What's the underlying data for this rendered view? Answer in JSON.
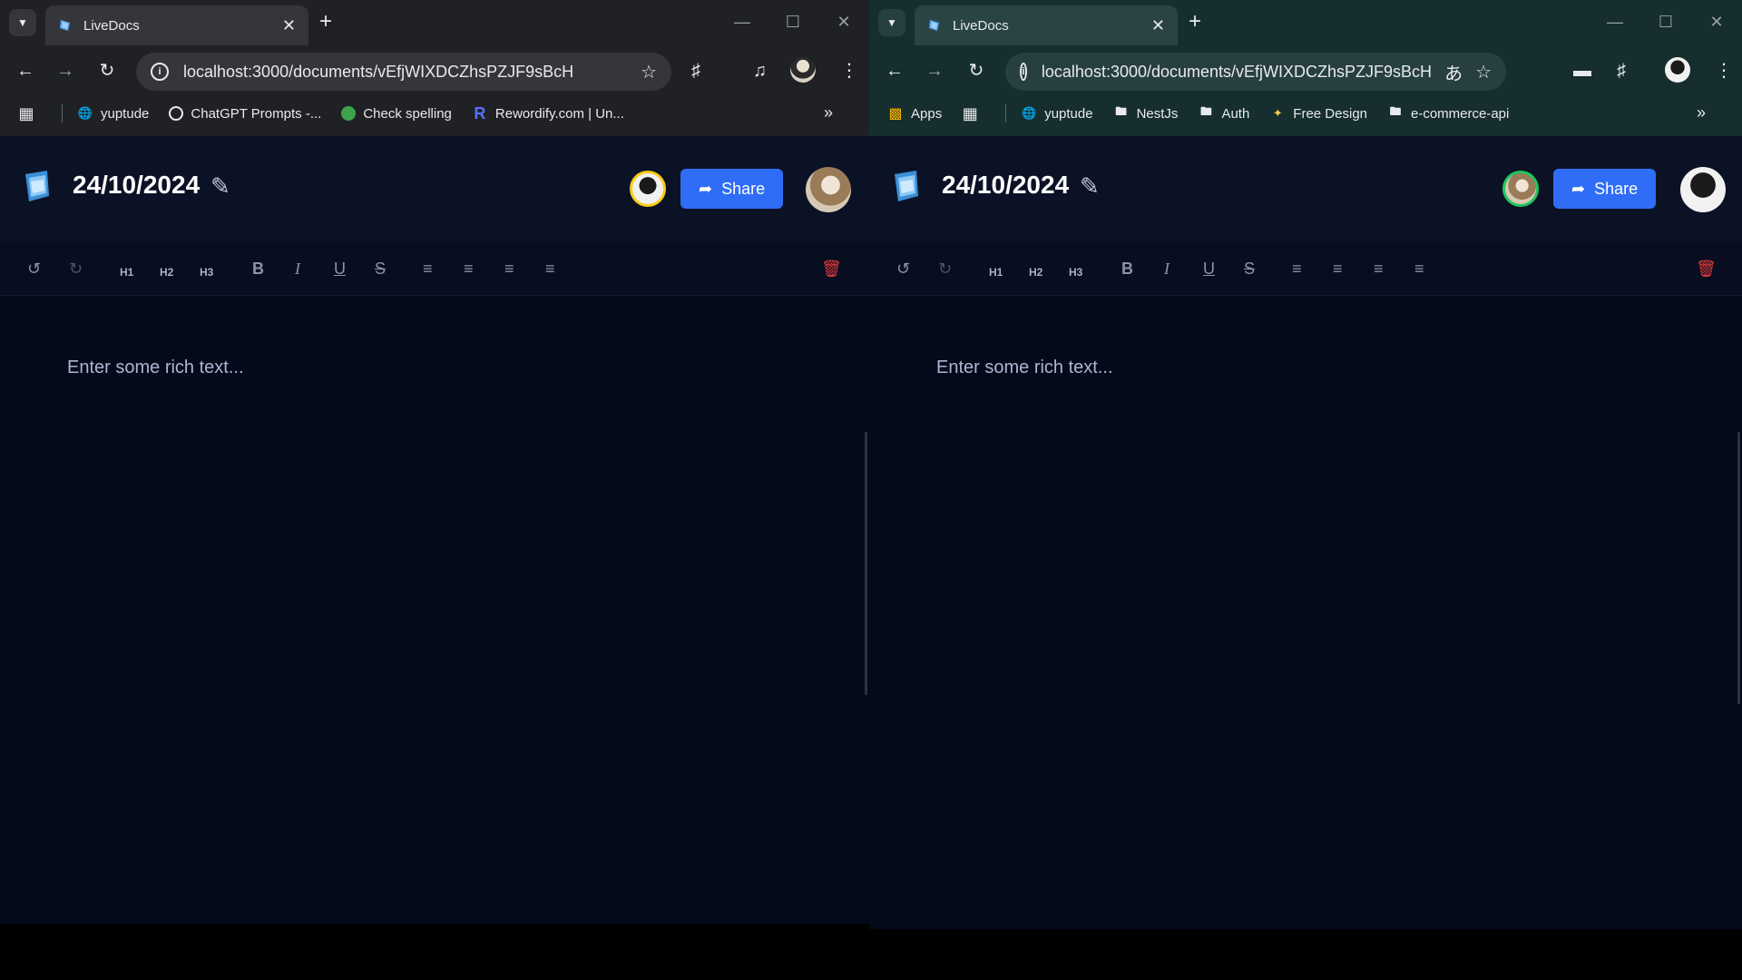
{
  "windows": [
    {
      "id": "left",
      "tab": {
        "title": "LiveDocs"
      },
      "url": "localhost:3000/documents/vEfjWIXDCZhsPZJF9sBcH",
      "bookmarks": [
        {
          "label": "yuptude",
          "icon": "globe-icon"
        },
        {
          "label": "ChatGPT Prompts -...",
          "icon": "chatgpt-prompts-icon"
        },
        {
          "label": "Check spelling",
          "icon": "spellcheck-icon"
        },
        {
          "label": "Rewordify.com | Un...",
          "icon": "rewordify-icon"
        }
      ],
      "app": {
        "doc_title": "24/10/2024",
        "share_label": "Share",
        "placeholder": "Enter some rich text...",
        "toolbar": {
          "h1": "H1",
          "h2": "H2",
          "h3": "H3",
          "bold": "B",
          "italic": "I",
          "underline": "U",
          "strike": "S"
        }
      }
    },
    {
      "id": "right",
      "tab": {
        "title": "LiveDocs"
      },
      "url": "localhost:3000/documents/vEfjWIXDCZhsPZJF9sBcH",
      "bookmarks": [
        {
          "label": "Apps",
          "icon": "apps-grid-icon"
        },
        {
          "label": "yuptude",
          "icon": "globe-icon"
        },
        {
          "label": "NestJs",
          "icon": "folder-icon"
        },
        {
          "label": "Auth",
          "icon": "folder-icon"
        },
        {
          "label": "Free Design",
          "icon": "free-design-icon"
        },
        {
          "label": "e-commerce-api",
          "icon": "folder-icon"
        }
      ],
      "app": {
        "doc_title": "24/10/2024",
        "share_label": "Share",
        "placeholder": "Enter some rich text...",
        "toolbar": {
          "h1": "H1",
          "h2": "H2",
          "h3": "H3",
          "bold": "B",
          "italic": "I",
          "underline": "U",
          "strike": "S"
        }
      }
    }
  ],
  "colors": {
    "share_button": "#2f6df6",
    "page_background": "#050a1a",
    "delete_icon": "#e23b3b",
    "left_browser_frame": "#202124",
    "right_browser_frame": "#162e2e"
  }
}
